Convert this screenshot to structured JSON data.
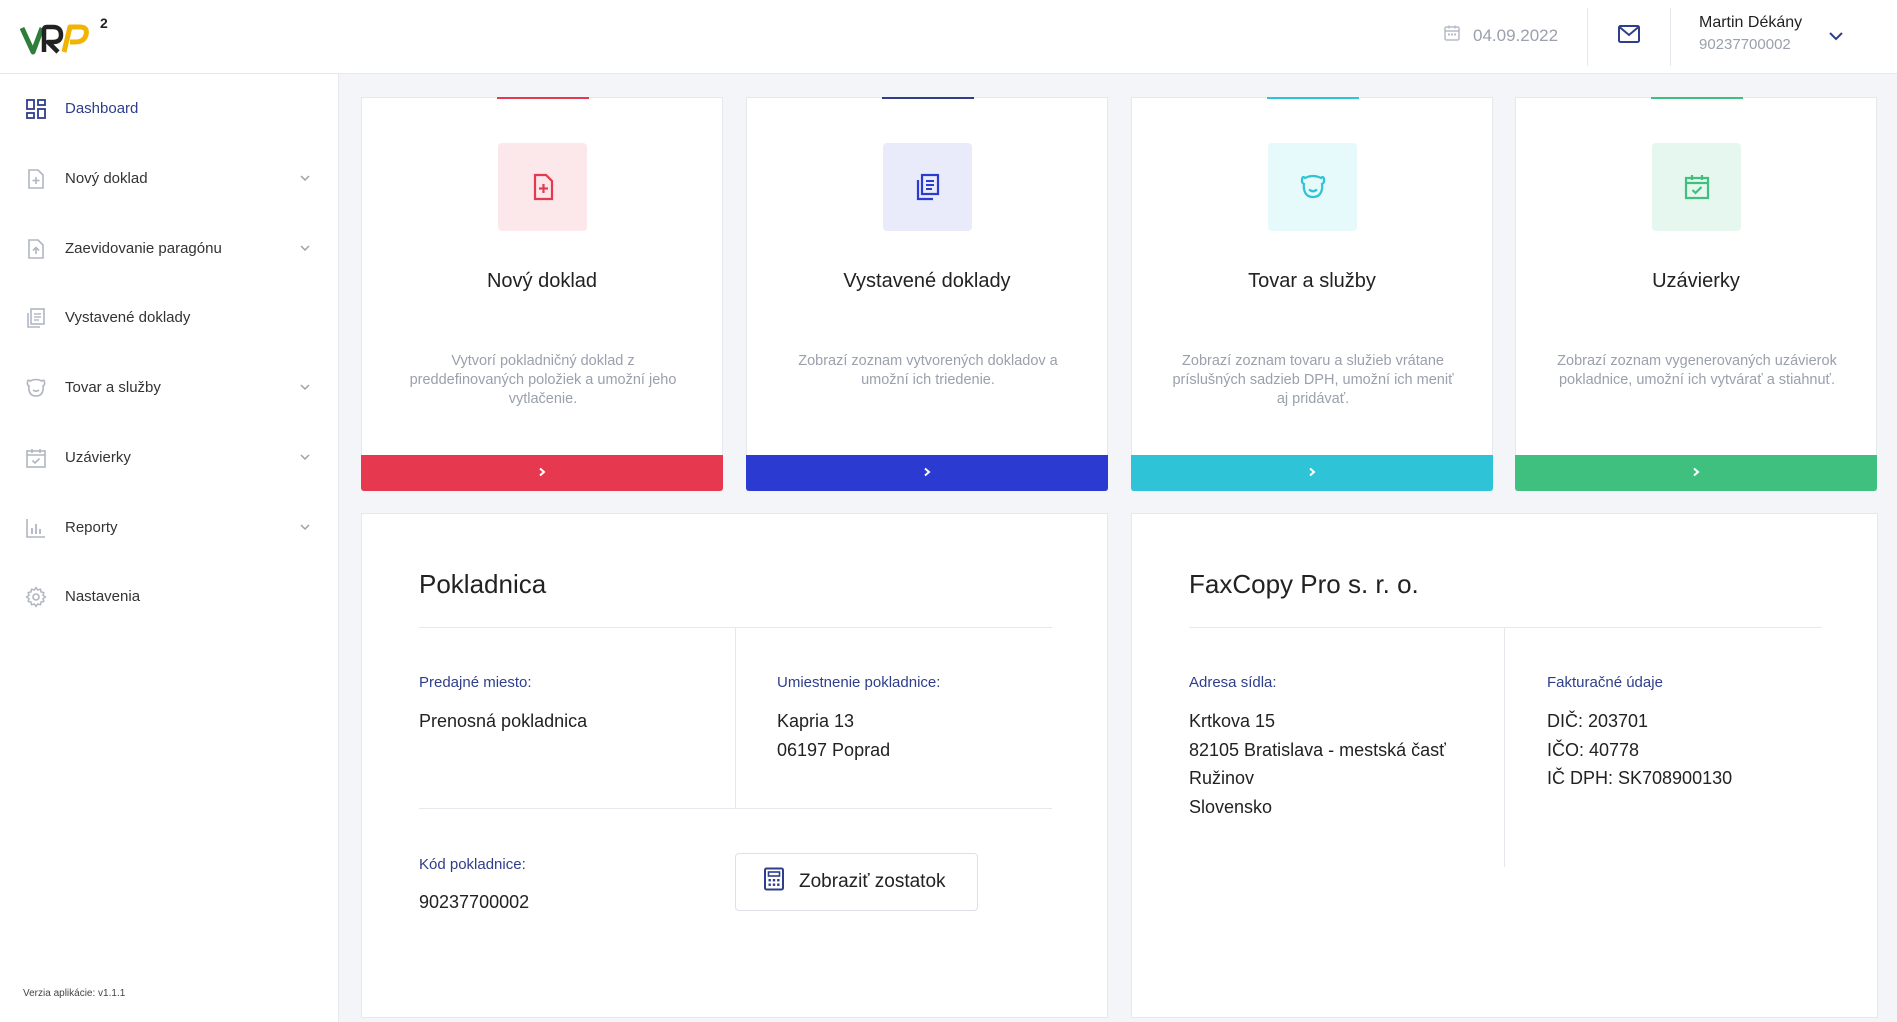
{
  "header": {
    "date": "04.09.2022",
    "user_name": "Martin Dékány",
    "user_id": "90237700002"
  },
  "sidebar": {
    "items": [
      {
        "label": "Dashboard"
      },
      {
        "label": "Nový doklad"
      },
      {
        "label": "Zaevidovanie paragónu"
      },
      {
        "label": "Vystavené doklady"
      },
      {
        "label": "Tovar a služby"
      },
      {
        "label": "Uzávierky"
      },
      {
        "label": "Reporty"
      },
      {
        "label": "Nastavenia"
      }
    ],
    "version": "Verzia aplikácie: v1.1.1"
  },
  "cards": [
    {
      "title": "Nový doklad",
      "desc": "Vytvorí pokladničný doklad z preddefinovaných položiek a umožní jeho vytlačenie.",
      "color": "#e63950",
      "tint": "#fce8ea"
    },
    {
      "title": "Vystavené doklady",
      "desc": "Zobrazí zoznam vytvorených dokladov a umožní ich triedenie.",
      "color": "#2b3bd1",
      "tint": "#e9ebfb"
    },
    {
      "title": "Tovar a služby",
      "desc": "Zobrazí zoznam tovaru a služieb vrátane príslušných sadzieb DPH, umožní ich meniť aj pridávať.",
      "color": "#2ec3d6",
      "tint": "#e6f9fb"
    },
    {
      "title": "Uzávierky",
      "desc": "Zobrazí zoznam vygenerovaných uzávierok pokladnice, umožní ich vytvárať a stiahnuť.",
      "color": "#3fc07f",
      "tint": "#e5f7ee"
    }
  ],
  "register": {
    "title": "Pokladnica",
    "sale_place_label": "Predajné miesto:",
    "sale_place_value": "Prenosná pokladnica",
    "location_label": "Umiestnenie pokladnice:",
    "location_line1": "Kapria 13",
    "location_line2": "06197 Poprad",
    "code_label": "Kód pokladnice:",
    "code_value": "90237700002",
    "balance_button": "Zobraziť zostatok"
  },
  "company": {
    "title": "FaxCopy Pro s. r. o.",
    "address_label": "Adresa sídla:",
    "address_line1": "Krtkova 15",
    "address_line2": "82105 Bratislava - mestská časť",
    "address_line3": "Ružinov",
    "address_line4": "Slovensko",
    "billing_label": "Fakturačné údaje",
    "dic": "DIČ: 203701",
    "ico": "IČO: 40778",
    "icdph": "IČ DPH: SK708900130"
  }
}
